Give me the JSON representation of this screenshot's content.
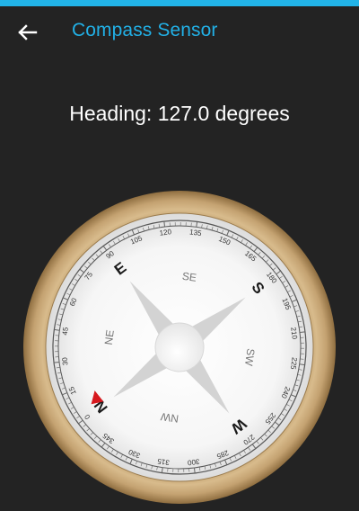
{
  "toolbar": {
    "title": "Compass Sensor",
    "back_icon": "arrow-left-icon"
  },
  "heading": {
    "value": 127.0,
    "text": "Heading: 127.0 degrees"
  },
  "compass": {
    "dial_rotation_deg": -127,
    "ring_labels": [
      "0",
      "15",
      "30",
      "45",
      "60",
      "75",
      "90",
      "105",
      "120",
      "135",
      "150",
      "165",
      "180",
      "195",
      "210",
      "225",
      "240",
      "255",
      "270",
      "285",
      "300",
      "315",
      "330",
      "345"
    ],
    "cardinals": [
      "N",
      "E",
      "S",
      "W"
    ],
    "intercardinals": [
      "NE",
      "SE",
      "SW",
      "NW"
    ],
    "colors": {
      "accent": "#22b4e8",
      "bezel": "#c8a877",
      "marker": "#d6181d",
      "face": "#f7f7f7"
    }
  }
}
